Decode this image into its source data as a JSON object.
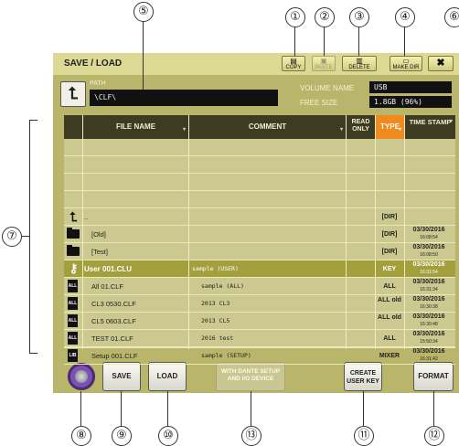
{
  "callouts": {
    "c1": "①",
    "c2": "②",
    "c3": "③",
    "c4": "④",
    "c5": "⑤",
    "c6": "⑥",
    "c7": "⑦",
    "c8": "⑧",
    "c9": "⑨",
    "c10": "⑩",
    "c11": "⑪",
    "c12": "⑫",
    "c13": "⑬"
  },
  "window": {
    "title": "SAVE / LOAD"
  },
  "toolbar": {
    "copy": "COPY",
    "paste": "PASTE",
    "delete": "DELETE",
    "make_dir": "MAKE DIR",
    "close": "✖"
  },
  "path": {
    "label": "PATH",
    "value": "\\CLF\\"
  },
  "volume": {
    "name_label": "VOLUME NAME",
    "name_value": "USB",
    "free_label": "FREE SIZE",
    "free_value": "1.8GB (96%)"
  },
  "table": {
    "headers": {
      "file_name": "FILE NAME",
      "comment": "COMMENT",
      "read_only": "READ ONLY",
      "type": "TYPE",
      "timestamp": "TIME STAMP"
    },
    "rows": [
      {
        "icon": "up",
        "name": "..",
        "comment": "",
        "type": "[DIR]",
        "ts_date": "",
        "ts_time": ""
      },
      {
        "icon": "folder",
        "name": "[Old]",
        "comment": "",
        "type": "[DIR]",
        "ts_date": "03/30/2016",
        "ts_time": "16:08:54"
      },
      {
        "icon": "folder",
        "name": "[Test]",
        "comment": "",
        "type": "[DIR]",
        "ts_date": "03/30/2016",
        "ts_time": "16:08:50"
      },
      {
        "icon": "key",
        "name": "User 001.CLU",
        "comment": "sample (USER)",
        "type": "KEY",
        "ts_date": "03/30/2016",
        "ts_time": "16:31:54"
      },
      {
        "icon": "all",
        "name": "All 01.CLF",
        "comment": "sample (ALL)",
        "type": "ALL",
        "ts_date": "03/30/2016",
        "ts_time": "16:31:34"
      },
      {
        "icon": "all",
        "name": "CL3 0530.CLF",
        "comment": "2013 CL3",
        "type": "ALL old",
        "ts_date": "03/30/2016",
        "ts_time": "16:30:38"
      },
      {
        "icon": "all",
        "name": "CL5 0603.CLF",
        "comment": "2013 CL5",
        "type": "ALL old",
        "ts_date": "03/30/2016",
        "ts_time": "16:30:48"
      },
      {
        "icon": "all",
        "name": "TEST 01.CLF",
        "comment": "2016 test",
        "type": "ALL",
        "ts_date": "03/30/2016",
        "ts_time": "15:50:34"
      },
      {
        "icon": "lib",
        "name": "Setup 001.CLF",
        "comment": "sample (SETUP)",
        "type": "MIXER",
        "ts_date": "03/30/2016",
        "ts_time": "16:31:42"
      }
    ],
    "icon_text": {
      "up": "⮤",
      "key": "⚷",
      "all": "ALL",
      "lib": "LIB"
    }
  },
  "buttons": {
    "save": "SAVE",
    "load": "LOAD",
    "dante": "WITH DANTE SETUP AND I/O DEVICE",
    "create_user_key": "CREATE USER KEY",
    "format": "FORMAT"
  },
  "colors": {
    "panel": "#b9b56a",
    "header": "#3d3c22",
    "type_header": "#f08a1c",
    "selected_row": "#a39f3c",
    "knob": "#7e4fb5"
  }
}
